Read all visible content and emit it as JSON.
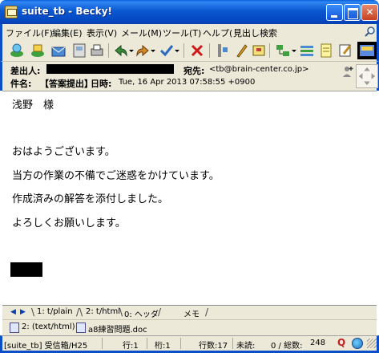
{
  "window": {
    "title": "suite_tb - Becky!"
  },
  "menu": {
    "items": [
      "ファイル(F)",
      "編集(E)",
      "表示(V)",
      "メール(M)",
      "ツール(T)",
      "ヘルプ(H)"
    ],
    "search_placeholder": "見出し検索"
  },
  "toolbar": {
    "icons": [
      "receive-mail-icon",
      "send-mail-icon",
      "new-mail-icon",
      "address-book-icon",
      "print-icon",
      "reply-icon",
      "forward-icon",
      "check-icon",
      "delete-icon",
      "filter-icon",
      "pen-icon",
      "notice-icon",
      "tree-icon",
      "task-icon",
      "memo-icon",
      "edit-icon",
      "view-icon"
    ]
  },
  "header": {
    "from_label": "差出人:",
    "to_label": "宛先:",
    "to_value": "<tb@brain-center.co.jp>",
    "subject_label": "件名:",
    "subject_value": "【答案提出】",
    "date_label": "日時:",
    "date_value": "Tue, 16 Apr 2013 07:58:55 +0900"
  },
  "body": {
    "lines": [
      "浅野　様",
      "",
      "",
      "おはようございます。",
      "当方の作業の不備でご迷惑をかけています。",
      "作成済みの解答を添付しました。",
      "よろしくお願いします。"
    ]
  },
  "tabs": [
    {
      "label": "1: t/plain"
    },
    {
      "label": "2: t/html"
    },
    {
      "label": "0: ヘッダ"
    },
    {
      "label": "メモ"
    }
  ],
  "attachments": [
    {
      "label": "2: (text/html)"
    },
    {
      "label": "a8練習問題.doc"
    }
  ],
  "status": {
    "folder": "[suite_tb] 受信箱/H25",
    "line": "行:1",
    "column": "桁:1",
    "lines_count": "行数:17",
    "unread": "未読:",
    "counts": "0 / 総数:",
    "total": "248"
  }
}
